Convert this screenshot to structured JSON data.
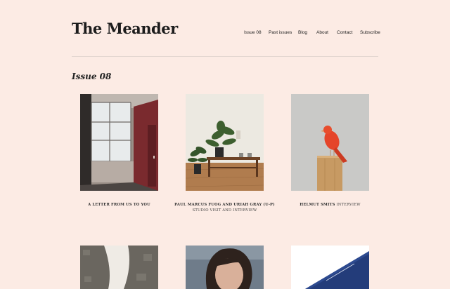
{
  "site": {
    "title": "The Meander"
  },
  "nav": [
    {
      "label": "Issue 08"
    },
    {
      "label": "Past issues"
    },
    {
      "label": "Blog"
    },
    {
      "label": "About"
    },
    {
      "label": "Contact"
    },
    {
      "label": "Subscribe"
    }
  ],
  "issue": {
    "heading": "Issue 08"
  },
  "articles": [
    {
      "title": "A Letter From Us To You",
      "kind": ""
    },
    {
      "title": "Paul Marcus Fuog and Uriah Gray (U-P)",
      "kind": "Studio Visit and Interview"
    },
    {
      "title": "Helmut Smits",
      "kind": "Interview"
    },
    {
      "title": "",
      "kind": ""
    },
    {
      "title": "",
      "kind": ""
    },
    {
      "title": "",
      "kind": ""
    }
  ],
  "colors": {
    "background": "#fcebe4",
    "text": "#1f1f1f",
    "divider": "#e3d6d0"
  }
}
